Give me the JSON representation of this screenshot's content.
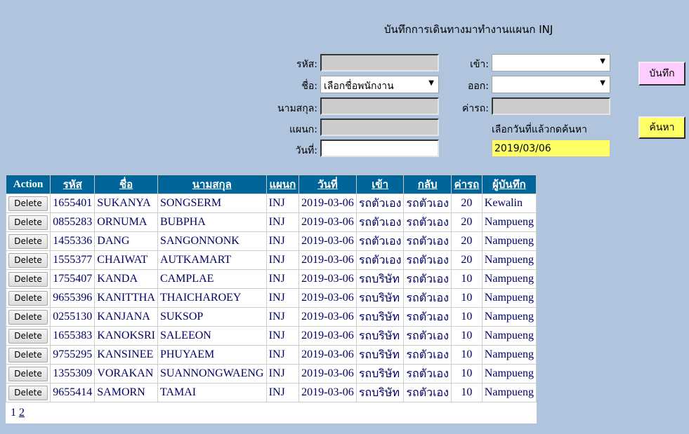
{
  "page": {
    "title": "บันทึกการเดินทางมาทำงานแผนก INJ"
  },
  "form": {
    "code_label": "รหัส:",
    "code_value": "",
    "name_label": "ชื่อ:",
    "name_selected": "เลือกชื่อพนักงาน",
    "surname_label": "นามสกุล:",
    "surname_value": "",
    "dept_label": "แผนก:",
    "dept_value": "",
    "date_label": "วันที่:",
    "date_value": "",
    "in_label": "เข้า:",
    "in_selected": "",
    "out_label": "ออก:",
    "out_selected": "",
    "fare_label": "ค่ารถ:",
    "fare_value": "",
    "search_hint": "เลือกวันที่แล้วกดค้นหา",
    "search_date": "2019/03/06",
    "save_label": "บันทึก",
    "search_label": "ค้นหา"
  },
  "colors": {
    "background": "#b0c4de",
    "header": "#006699",
    "save_button": "#ffccff",
    "search_button": "#ffff66",
    "cell_text": "#000066"
  },
  "table": {
    "headers": [
      "Action",
      "รหัส",
      "ชื่อ",
      "นามสกุล",
      "แผนก",
      "วันที่",
      "เข้า",
      "กลับ",
      "ค่ารถ",
      "ผู้บันทึก"
    ],
    "delete_label": "Delete",
    "rows": [
      {
        "code": "1655401",
        "name": "SUKANYA",
        "surname": "SONGSERM",
        "dept": "INJ",
        "date": "2019-03-06",
        "in": "รถตัวเอง",
        "out": "รถตัวเอง",
        "fare": "20",
        "by": "Kewalin"
      },
      {
        "code": "0855283",
        "name": "ORNUMA",
        "surname": "BUBPHA",
        "dept": "INJ",
        "date": "2019-03-06",
        "in": "รถตัวเอง",
        "out": "รถตัวเอง",
        "fare": "20",
        "by": "Nampueng"
      },
      {
        "code": "1455336",
        "name": "DANG",
        "surname": "SANGONNONK",
        "dept": "INJ",
        "date": "2019-03-06",
        "in": "รถตัวเอง",
        "out": "รถตัวเอง",
        "fare": "20",
        "by": "Nampueng"
      },
      {
        "code": "1555377",
        "name": "CHAIWAT",
        "surname": "AUTKAMART",
        "dept": "INJ",
        "date": "2019-03-06",
        "in": "รถตัวเอง",
        "out": "รถตัวเอง",
        "fare": "20",
        "by": "Nampueng"
      },
      {
        "code": "1755407",
        "name": "KANDA",
        "surname": "CAMPLAE",
        "dept": "INJ",
        "date": "2019-03-06",
        "in": "รถบริษัท",
        "out": "รถตัวเอง",
        "fare": "10",
        "by": "Nampueng"
      },
      {
        "code": "9655396",
        "name": "KANITTHA",
        "surname": "THAICHAROEY",
        "dept": "INJ",
        "date": "2019-03-06",
        "in": "รถบริษัท",
        "out": "รถตัวเอง",
        "fare": "10",
        "by": "Nampueng"
      },
      {
        "code": "0255130",
        "name": "KANJANA",
        "surname": "SUKSOP",
        "dept": "INJ",
        "date": "2019-03-06",
        "in": "รถบริษัท",
        "out": "รถตัวเอง",
        "fare": "10",
        "by": "Nampueng"
      },
      {
        "code": "1655383",
        "name": "KANOKSRI",
        "surname": "SALEEON",
        "dept": "INJ",
        "date": "2019-03-06",
        "in": "รถบริษัท",
        "out": "รถตัวเอง",
        "fare": "10",
        "by": "Nampueng"
      },
      {
        "code": "9755295",
        "name": "KANSINEE",
        "surname": "PHUYAEM",
        "dept": "INJ",
        "date": "2019-03-06",
        "in": "รถบริษัท",
        "out": "รถตัวเอง",
        "fare": "10",
        "by": "Nampueng"
      },
      {
        "code": "1355309",
        "name": "VORAKAN",
        "surname": "SUANNONGWAENG",
        "dept": "INJ",
        "date": "2019-03-06",
        "in": "รถบริษัท",
        "out": "รถตัวเอง",
        "fare": "10",
        "by": "Nampueng"
      },
      {
        "code": "9655414",
        "name": "SAMORN",
        "surname": "TAMAI",
        "dept": "INJ",
        "date": "2019-03-06",
        "in": "รถบริษัท",
        "out": "รถตัวเอง",
        "fare": "10",
        "by": "Nampueng"
      }
    ]
  },
  "pager": {
    "current": "1",
    "pages": [
      "2"
    ]
  }
}
